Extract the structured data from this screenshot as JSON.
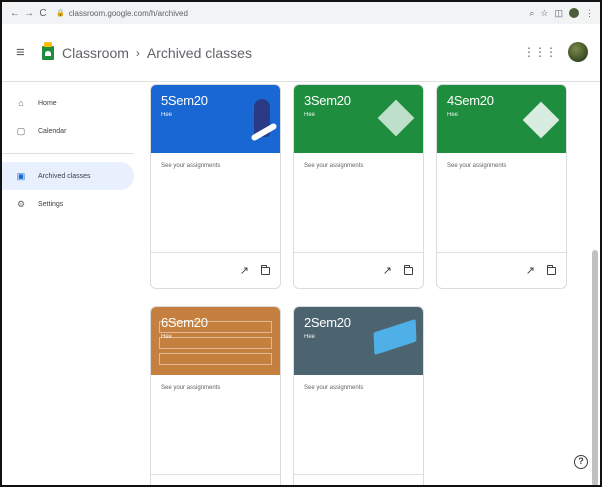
{
  "browser": {
    "back": "←",
    "forward": "→",
    "reload": "C",
    "url": "classroom.google.com/h/archived",
    "right_icons": [
      "⌕",
      "☆",
      "◫",
      "⋮"
    ]
  },
  "header": {
    "menu_icon": "≡",
    "app_name": "Classroom",
    "separator": "›",
    "page_title": "Archived classes",
    "apps_icon": "⋮⋮⋮"
  },
  "sidebar": {
    "items": [
      {
        "label": "Home",
        "icon": "⌂"
      },
      {
        "label": "Calendar",
        "icon": "▢"
      },
      {
        "label": "Archived classes",
        "icon": "▣",
        "active": true
      },
      {
        "label": "Settings",
        "icon": "⚙"
      }
    ]
  },
  "cards": [
    {
      "title": "5Sem20",
      "subtitle": "Hee",
      "body": "See your assignments",
      "color": "#1967d2",
      "trend_icon": "↗"
    },
    {
      "title": "3Sem20",
      "subtitle": "Hee",
      "body": "See your assignments",
      "color": "#1e8e3e",
      "trend_icon": "↗"
    },
    {
      "title": "4Sem20",
      "subtitle": "Hee",
      "body": "See your assignments",
      "color": "#1e8e3e",
      "trend_icon": "↗"
    },
    {
      "title": "6Sem20",
      "subtitle": "Hee",
      "body": "See your assignments",
      "color": "#c5803f",
      "trend_icon": "↗"
    },
    {
      "title": "2Sem20",
      "subtitle": "Hee",
      "body": "See your assignments",
      "color": "#4c6470",
      "trend_icon": "↗"
    }
  ],
  "help_label": "?"
}
